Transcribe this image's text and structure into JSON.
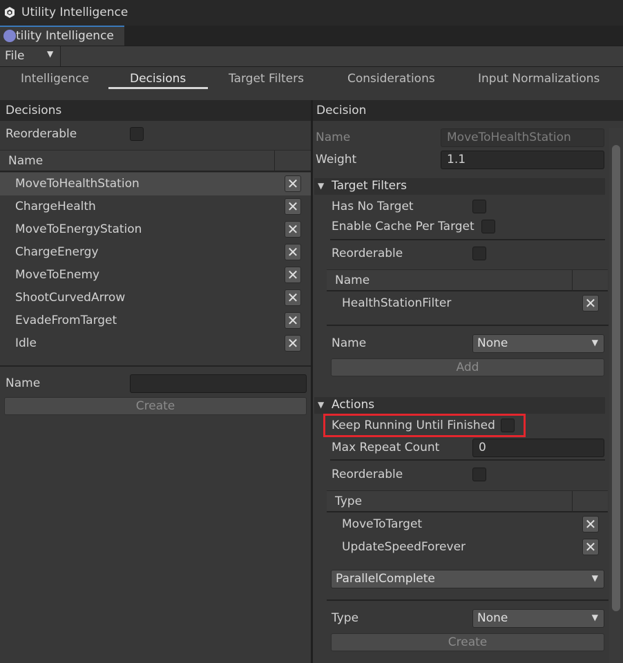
{
  "window": {
    "title": "Utility Intelligence",
    "doc_tab": "tility Intelligence"
  },
  "toolbar": {
    "file_label": "File"
  },
  "tabs": [
    {
      "label": "Intelligence"
    },
    {
      "label": "Decisions"
    },
    {
      "label": "Target Filters"
    },
    {
      "label": "Considerations"
    },
    {
      "label": "Input Normalizations"
    }
  ],
  "active_tab": "Decisions",
  "left": {
    "header": "Decisions",
    "reorderable_label": "Reorderable",
    "reorderable_checked": false,
    "column_name": "Name",
    "items": [
      {
        "label": "MoveToHealthStation",
        "selected": true
      },
      {
        "label": "ChargeHealth",
        "selected": false
      },
      {
        "label": "MoveToEnergyStation",
        "selected": false
      },
      {
        "label": "ChargeEnergy",
        "selected": false
      },
      {
        "label": "MoveToEnemy",
        "selected": false
      },
      {
        "label": "ShootCurvedArrow",
        "selected": false
      },
      {
        "label": "EvadeFromTarget",
        "selected": false
      },
      {
        "label": "Idle",
        "selected": false
      }
    ],
    "name_label": "Name",
    "name_value": "",
    "create_label": "Create"
  },
  "right": {
    "header": "Decision",
    "name_label": "Name",
    "name_value": "MoveToHealthStation",
    "weight_label": "Weight",
    "weight_value": "1.1",
    "target_filters": {
      "title": "Target Filters",
      "has_no_target_label": "Has No Target",
      "enable_cache_label": "Enable Cache Per Target",
      "reorderable_label": "Reorderable",
      "column_name": "Name",
      "items": [
        {
          "label": "HealthStationFilter"
        }
      ],
      "name_label": "Name",
      "name_dropdown": "None",
      "add_label": "Add"
    },
    "actions": {
      "title": "Actions",
      "keep_running_label": "Keep Running Until Finished",
      "max_repeat_label": "Max Repeat Count",
      "max_repeat_value": "0",
      "reorderable_label": "Reorderable",
      "column_type": "Type",
      "items": [
        {
          "label": "MoveToTarget"
        },
        {
          "label": "UpdateSpeedForever"
        }
      ],
      "mode_dropdown": "ParallelComplete",
      "type_label": "Type",
      "type_dropdown": "None",
      "create_label": "Create"
    }
  },
  "colors": {
    "highlight": "#e3262d",
    "accent": "#3a79bb"
  }
}
